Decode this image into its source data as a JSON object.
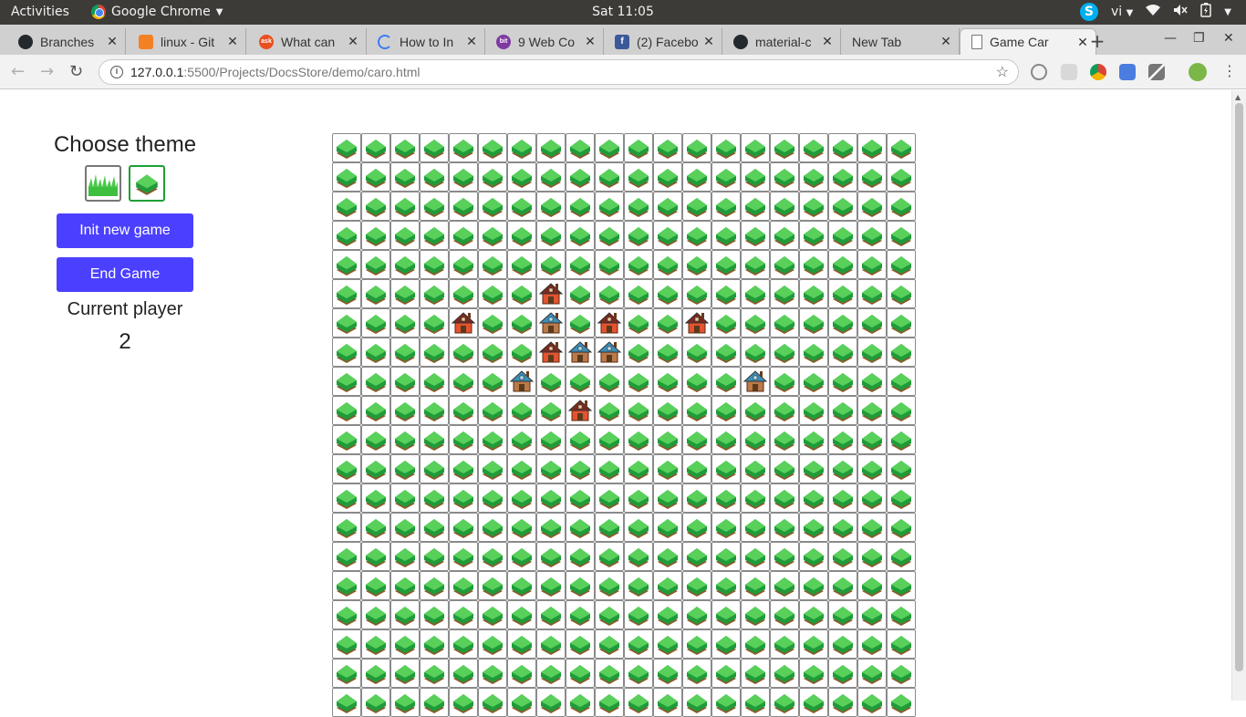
{
  "os": {
    "activities": "Activities",
    "app_menu": "Google Chrome",
    "clock": "Sat 11:05",
    "keyboard_layout": "vi"
  },
  "browser": {
    "tabs": [
      {
        "title": "Branches",
        "icon": "github-icon",
        "color": "#24292e"
      },
      {
        "title": "linux - Git",
        "icon": "stackoverflow-icon",
        "color": "#f48024"
      },
      {
        "title": "What can",
        "icon": "ask-icon",
        "color": "#e9501f"
      },
      {
        "title": "How to In",
        "icon": "loading-icon",
        "color": "#3d7cf2"
      },
      {
        "title": "9 Web Co",
        "icon": "bit-icon",
        "color": "#7e3aa0"
      },
      {
        "title": "(2) Facebo",
        "icon": "facebook-icon",
        "color": "#3b5998"
      },
      {
        "title": "material-c",
        "icon": "github-icon",
        "color": "#24292e"
      },
      {
        "title": "New Tab",
        "icon": "",
        "color": ""
      },
      {
        "title": "Game Car",
        "icon": "page-icon",
        "color": "#777777"
      }
    ],
    "active_tab": 8,
    "url_host": "127.0.0.1",
    "url_path": ":5500/Projects/DocsStore/demo/caro.html"
  },
  "sidebar": {
    "title": "Choose theme",
    "themes": [
      {
        "name": "grass",
        "selected": false
      },
      {
        "name": "house",
        "selected": true
      }
    ],
    "init_button": "Init new game",
    "end_button": "End Game",
    "current_player_label": "Current player",
    "current_player_value": "2"
  },
  "board": {
    "columns": 20,
    "rows_visible": 20,
    "empty_icon": "grass-tile-icon",
    "red_icon": "red-house-icon",
    "blue_icon": "blue-house-icon",
    "pieces": [
      {
        "row": 5,
        "col": 7,
        "player": "red"
      },
      {
        "row": 6,
        "col": 4,
        "player": "red"
      },
      {
        "row": 6,
        "col": 7,
        "player": "blue"
      },
      {
        "row": 6,
        "col": 9,
        "player": "red"
      },
      {
        "row": 6,
        "col": 12,
        "player": "red"
      },
      {
        "row": 7,
        "col": 7,
        "player": "red"
      },
      {
        "row": 7,
        "col": 8,
        "player": "blue"
      },
      {
        "row": 7,
        "col": 9,
        "player": "blue"
      },
      {
        "row": 8,
        "col": 6,
        "player": "blue"
      },
      {
        "row": 8,
        "col": 14,
        "player": "blue"
      },
      {
        "row": 9,
        "col": 8,
        "player": "red"
      }
    ]
  }
}
